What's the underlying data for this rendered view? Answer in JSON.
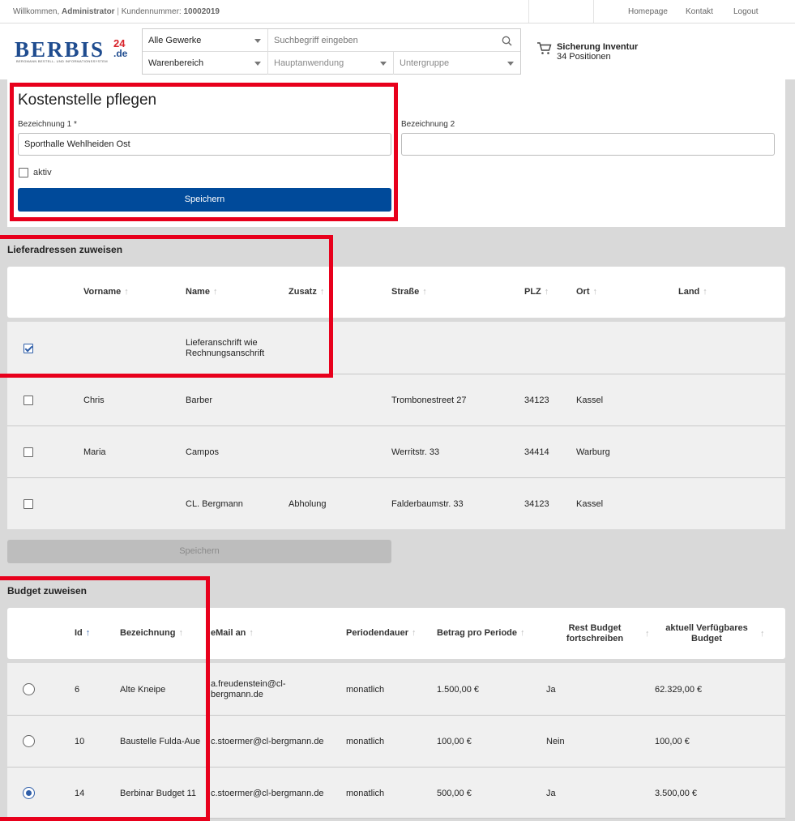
{
  "topbar": {
    "welcome_prefix": "Willkommen,",
    "user": "Administrator",
    "customer_label": "Kundennummer:",
    "customer_number": "10002019",
    "links": [
      "Homepage",
      "Kontakt",
      "Logout"
    ]
  },
  "logo": {
    "text": "BERBIS",
    "number": "24",
    "suffix": ".de",
    "tagline": "BERGMANN BESTELL- UND INFORMATIONSSYSTEM"
  },
  "search": {
    "trade": "Alle Gewerke",
    "placeholder": "Suchbegriff eingeben",
    "product_area": "Warenbereich",
    "main_application": "Hauptanwendung",
    "subgroup": "Untergruppe"
  },
  "cart": {
    "title": "Sicherung Inventur",
    "count": "34 Positionen"
  },
  "cost_center": {
    "title": "Kostenstelle pflegen",
    "label1": "Bezeichnung 1 *",
    "value1": "Sporthalle Wehlheiden Ost",
    "label2": "Bezeichnung 2",
    "value2": "",
    "active_label": "aktiv",
    "active": false,
    "save": "Speichern"
  },
  "delivery": {
    "title": "Lieferadressen zuweisen",
    "columns": [
      "Vorname",
      "Name",
      "Zusatz",
      "Straße",
      "PLZ",
      "Ort",
      "Land"
    ],
    "rows": [
      {
        "checked": true,
        "vorname": "",
        "name": "Lieferanschrift wie",
        "name2": "Rechnungsanschrift",
        "zusatz": "",
        "strasse": "",
        "plz": "",
        "ort": "",
        "land": ""
      },
      {
        "checked": false,
        "vorname": "Chris",
        "name": "Barber",
        "name2": "",
        "zusatz": "",
        "strasse": "Trombonestreet 27",
        "plz": "34123",
        "ort": "Kassel",
        "land": ""
      },
      {
        "checked": false,
        "vorname": "Maria",
        "name": "Campos",
        "name2": "",
        "zusatz": "",
        "strasse": "Werritstr. 33",
        "plz": "34414",
        "ort": "Warburg",
        "land": ""
      },
      {
        "checked": false,
        "vorname": "",
        "name": "CL. Bergmann",
        "name2": "",
        "zusatz": "Abholung",
        "strasse": "Falderbaumstr. 33",
        "plz": "34123",
        "ort": "Kassel",
        "land": ""
      }
    ],
    "save": "Speichern"
  },
  "budget": {
    "title": "Budget zuweisen",
    "columns": {
      "id": "Id",
      "bezeichnung": "Bezeichnung",
      "email": "eMail an",
      "periode": "Periodendauer",
      "betrag": "Betrag pro Periode",
      "rest1": "Rest Budget",
      "rest2": "fortschreiben",
      "verf1": "aktuell Verfügbares",
      "verf2": "Budget"
    },
    "rows": [
      {
        "selected": false,
        "id": "6",
        "bezeichnung": "Alte Kneipe",
        "email1": "a.freudenstein@cl-",
        "email2": "bergmann.de",
        "periode": "monatlich",
        "betrag": "1.500,00 €",
        "rest": "Ja",
        "verfuegbar": "62.329,00 €"
      },
      {
        "selected": false,
        "id": "10",
        "bezeichnung": "Baustelle Fulda-Aue",
        "email1": "c.stoermer@cl-bergmann.de",
        "email2": "",
        "periode": "monatlich",
        "betrag": "100,00 €",
        "rest": "Nein",
        "verfuegbar": "100,00 €"
      },
      {
        "selected": true,
        "id": "14",
        "bezeichnung": "Berbinar Budget 11",
        "email1": "c.stoermer@cl-bergmann.de",
        "email2": "",
        "periode": "monatlich",
        "betrag": "500,00 €",
        "rest": "Ja",
        "verfuegbar": "3.500,00 €"
      }
    ]
  },
  "colors": {
    "primary": "#004a9a",
    "highlight": "#e8001c",
    "logo_blue": "#1f4c8f",
    "logo_red": "#d8232a"
  }
}
